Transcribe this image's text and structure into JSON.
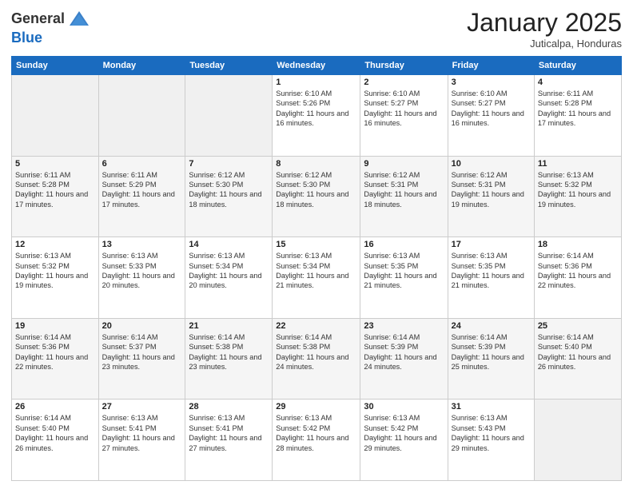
{
  "header": {
    "logo_general": "General",
    "logo_blue": "Blue",
    "month_title": "January 2025",
    "location": "Juticalpa, Honduras"
  },
  "weekdays": [
    "Sunday",
    "Monday",
    "Tuesday",
    "Wednesday",
    "Thursday",
    "Friday",
    "Saturday"
  ],
  "weeks": [
    [
      {
        "day": "",
        "info": ""
      },
      {
        "day": "",
        "info": ""
      },
      {
        "day": "",
        "info": ""
      },
      {
        "day": "1",
        "info": "Sunrise: 6:10 AM\nSunset: 5:26 PM\nDaylight: 11 hours and 16 minutes."
      },
      {
        "day": "2",
        "info": "Sunrise: 6:10 AM\nSunset: 5:27 PM\nDaylight: 11 hours and 16 minutes."
      },
      {
        "day": "3",
        "info": "Sunrise: 6:10 AM\nSunset: 5:27 PM\nDaylight: 11 hours and 16 minutes."
      },
      {
        "day": "4",
        "info": "Sunrise: 6:11 AM\nSunset: 5:28 PM\nDaylight: 11 hours and 17 minutes."
      }
    ],
    [
      {
        "day": "5",
        "info": "Sunrise: 6:11 AM\nSunset: 5:28 PM\nDaylight: 11 hours and 17 minutes."
      },
      {
        "day": "6",
        "info": "Sunrise: 6:11 AM\nSunset: 5:29 PM\nDaylight: 11 hours and 17 minutes."
      },
      {
        "day": "7",
        "info": "Sunrise: 6:12 AM\nSunset: 5:30 PM\nDaylight: 11 hours and 18 minutes."
      },
      {
        "day": "8",
        "info": "Sunrise: 6:12 AM\nSunset: 5:30 PM\nDaylight: 11 hours and 18 minutes."
      },
      {
        "day": "9",
        "info": "Sunrise: 6:12 AM\nSunset: 5:31 PM\nDaylight: 11 hours and 18 minutes."
      },
      {
        "day": "10",
        "info": "Sunrise: 6:12 AM\nSunset: 5:31 PM\nDaylight: 11 hours and 19 minutes."
      },
      {
        "day": "11",
        "info": "Sunrise: 6:13 AM\nSunset: 5:32 PM\nDaylight: 11 hours and 19 minutes."
      }
    ],
    [
      {
        "day": "12",
        "info": "Sunrise: 6:13 AM\nSunset: 5:32 PM\nDaylight: 11 hours and 19 minutes."
      },
      {
        "day": "13",
        "info": "Sunrise: 6:13 AM\nSunset: 5:33 PM\nDaylight: 11 hours and 20 minutes."
      },
      {
        "day": "14",
        "info": "Sunrise: 6:13 AM\nSunset: 5:34 PM\nDaylight: 11 hours and 20 minutes."
      },
      {
        "day": "15",
        "info": "Sunrise: 6:13 AM\nSunset: 5:34 PM\nDaylight: 11 hours and 21 minutes."
      },
      {
        "day": "16",
        "info": "Sunrise: 6:13 AM\nSunset: 5:35 PM\nDaylight: 11 hours and 21 minutes."
      },
      {
        "day": "17",
        "info": "Sunrise: 6:13 AM\nSunset: 5:35 PM\nDaylight: 11 hours and 21 minutes."
      },
      {
        "day": "18",
        "info": "Sunrise: 6:14 AM\nSunset: 5:36 PM\nDaylight: 11 hours and 22 minutes."
      }
    ],
    [
      {
        "day": "19",
        "info": "Sunrise: 6:14 AM\nSunset: 5:36 PM\nDaylight: 11 hours and 22 minutes."
      },
      {
        "day": "20",
        "info": "Sunrise: 6:14 AM\nSunset: 5:37 PM\nDaylight: 11 hours and 23 minutes."
      },
      {
        "day": "21",
        "info": "Sunrise: 6:14 AM\nSunset: 5:38 PM\nDaylight: 11 hours and 23 minutes."
      },
      {
        "day": "22",
        "info": "Sunrise: 6:14 AM\nSunset: 5:38 PM\nDaylight: 11 hours and 24 minutes."
      },
      {
        "day": "23",
        "info": "Sunrise: 6:14 AM\nSunset: 5:39 PM\nDaylight: 11 hours and 24 minutes."
      },
      {
        "day": "24",
        "info": "Sunrise: 6:14 AM\nSunset: 5:39 PM\nDaylight: 11 hours and 25 minutes."
      },
      {
        "day": "25",
        "info": "Sunrise: 6:14 AM\nSunset: 5:40 PM\nDaylight: 11 hours and 26 minutes."
      }
    ],
    [
      {
        "day": "26",
        "info": "Sunrise: 6:14 AM\nSunset: 5:40 PM\nDaylight: 11 hours and 26 minutes."
      },
      {
        "day": "27",
        "info": "Sunrise: 6:13 AM\nSunset: 5:41 PM\nDaylight: 11 hours and 27 minutes."
      },
      {
        "day": "28",
        "info": "Sunrise: 6:13 AM\nSunset: 5:41 PM\nDaylight: 11 hours and 27 minutes."
      },
      {
        "day": "29",
        "info": "Sunrise: 6:13 AM\nSunset: 5:42 PM\nDaylight: 11 hours and 28 minutes."
      },
      {
        "day": "30",
        "info": "Sunrise: 6:13 AM\nSunset: 5:42 PM\nDaylight: 11 hours and 29 minutes."
      },
      {
        "day": "31",
        "info": "Sunrise: 6:13 AM\nSunset: 5:43 PM\nDaylight: 11 hours and 29 minutes."
      },
      {
        "day": "",
        "info": ""
      }
    ]
  ]
}
